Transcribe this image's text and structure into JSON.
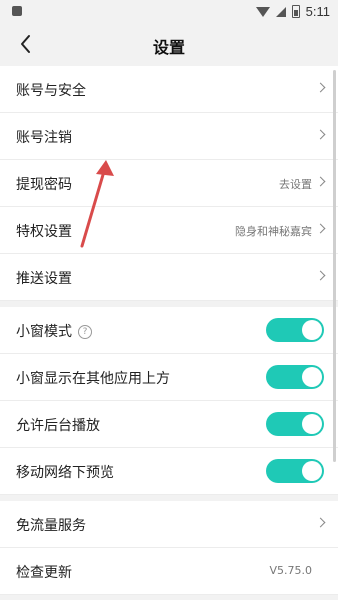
{
  "status": {
    "time": "5:11"
  },
  "header": {
    "title": "设置"
  },
  "settings": [
    {
      "label": "账号与安全",
      "type": "nav"
    },
    {
      "label": "账号注销",
      "type": "nav"
    },
    {
      "label": "提现密码",
      "type": "nav",
      "value": "去设置"
    },
    {
      "label": "特权设置",
      "type": "nav",
      "value": "隐身和神秘嘉宾"
    },
    {
      "label": "推送设置",
      "type": "nav"
    },
    {
      "label": "小窗模式",
      "type": "toggle",
      "on": true
    },
    {
      "label": "小窗显示在其他应用上方",
      "type": "toggle",
      "on": true
    },
    {
      "label": "允许后台播放",
      "type": "toggle",
      "on": true
    },
    {
      "label": "移动网络下预览",
      "type": "toggle",
      "on": true
    },
    {
      "label": "免流量服务",
      "type": "nav"
    },
    {
      "label": "检查更新",
      "type": "nav",
      "value": "V5.75.0"
    }
  ],
  "colors": {
    "toggle_on": "#1fc9b6",
    "arrow": "#d94b4b"
  }
}
